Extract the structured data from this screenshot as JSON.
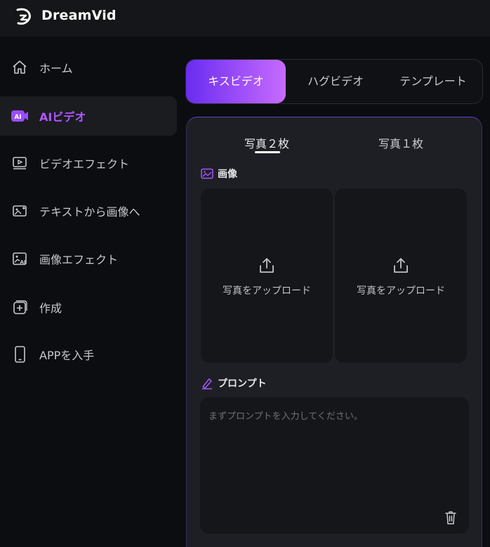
{
  "header": {
    "brand": "DreamVid",
    "logo_icon": "dreamvid-logo-icon"
  },
  "sidebar": {
    "items": [
      {
        "label": "ホーム",
        "icon": "home-icon",
        "active": false
      },
      {
        "label": "AIビデオ",
        "icon": "ai-badge-icon",
        "active": true
      },
      {
        "label": "ビデオエフェクト",
        "icon": "video-effect-icon",
        "active": false
      },
      {
        "label": "テキストから画像へ",
        "icon": "text-to-image-icon",
        "active": false
      },
      {
        "label": "画像エフェクト",
        "icon": "image-effect-icon",
        "active": false
      },
      {
        "label": "作成",
        "icon": "create-plus-icon",
        "active": false
      },
      {
        "label": "APPを入手",
        "icon": "phone-icon",
        "active": false
      }
    ]
  },
  "main": {
    "tabs": [
      {
        "label": "キスビデオ",
        "active": true
      },
      {
        "label": "ハグビデオ",
        "active": false
      },
      {
        "label": "テンプレート",
        "active": false
      }
    ],
    "photo_tabs": [
      {
        "label": "写真２枚",
        "active": true
      },
      {
        "label": "写真１枚",
        "active": false
      }
    ],
    "image_section": {
      "title": "画像",
      "uploads": [
        {
          "label": "写真をアップロード"
        },
        {
          "label": "写真をアップロード"
        }
      ]
    },
    "prompt_section": {
      "title": "プロンプト",
      "placeholder": "まずプロンプトを入力してください。",
      "value": ""
    }
  },
  "colors": {
    "accent": "#b257ff",
    "gradient_start": "#6a2cf0",
    "gradient_end": "#c76bff",
    "background": "#0b0d10",
    "panel": "#1e1f24"
  }
}
